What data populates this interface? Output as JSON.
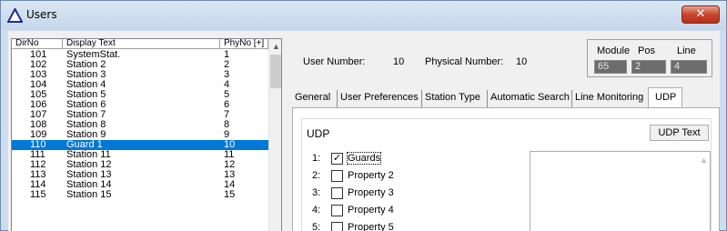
{
  "window": {
    "title": "Users",
    "close_label": "✕"
  },
  "list": {
    "columns": {
      "dirno": "DirNo",
      "display_text": "Display Text",
      "phyno": "PhyNo [+]"
    },
    "rows": [
      {
        "dirno": "101",
        "text": "SystemStat.",
        "phyno": "1"
      },
      {
        "dirno": "102",
        "text": "Station 2",
        "phyno": "2"
      },
      {
        "dirno": "103",
        "text": "Station 3",
        "phyno": "3"
      },
      {
        "dirno": "104",
        "text": "Station 4",
        "phyno": "4"
      },
      {
        "dirno": "105",
        "text": "Station 5",
        "phyno": "5"
      },
      {
        "dirno": "106",
        "text": "Station 6",
        "phyno": "6"
      },
      {
        "dirno": "107",
        "text": "Station 7",
        "phyno": "7"
      },
      {
        "dirno": "108",
        "text": "Station 8",
        "phyno": "8"
      },
      {
        "dirno": "109",
        "text": "Station 9",
        "phyno": "9"
      },
      {
        "dirno": "110",
        "text": "Guard 1",
        "phyno": "10",
        "selected": true
      },
      {
        "dirno": "111",
        "text": "Station 11",
        "phyno": "11"
      },
      {
        "dirno": "112",
        "text": "Station 12",
        "phyno": "12"
      },
      {
        "dirno": "113",
        "text": "Station 13",
        "phyno": "13"
      },
      {
        "dirno": "114",
        "text": "Station 14",
        "phyno": "14"
      },
      {
        "dirno": "115",
        "text": "Station 15",
        "phyno": "15"
      }
    ],
    "selection_color": "#0078d7"
  },
  "info": {
    "user_number_label": "User Number:",
    "user_number": "10",
    "physical_number_label": "Physical Number:",
    "physical_number": "10",
    "module_label": "Module",
    "pos_label": "Pos",
    "line_label": "Line",
    "module": "65",
    "pos": "2",
    "line": "4"
  },
  "tabs": {
    "general": "General",
    "user_preferences": "User Preferences",
    "station_type": "Station Type",
    "automatic_search": "Automatic Search",
    "line_monitoring": "Line Monitoring",
    "udp": "UDP",
    "active": "UDP"
  },
  "udp": {
    "title": "UDP",
    "udp_text_button": "UDP Text",
    "properties": [
      {
        "num": "1:",
        "label": "Guards",
        "checked": true,
        "check_mark": "✓"
      },
      {
        "num": "2:",
        "label": "Property 2",
        "checked": false,
        "check_mark": ""
      },
      {
        "num": "3:",
        "label": "Property 3",
        "checked": false,
        "check_mark": ""
      },
      {
        "num": "4:",
        "label": "Property 4",
        "checked": false,
        "check_mark": ""
      },
      {
        "num": "5:",
        "label": "Property 5",
        "checked": false,
        "check_mark": ""
      }
    ]
  },
  "colors": {
    "titlebar": "#cfdced",
    "close_button": "#c8452f",
    "disabled_field": "#6d6d6d"
  }
}
